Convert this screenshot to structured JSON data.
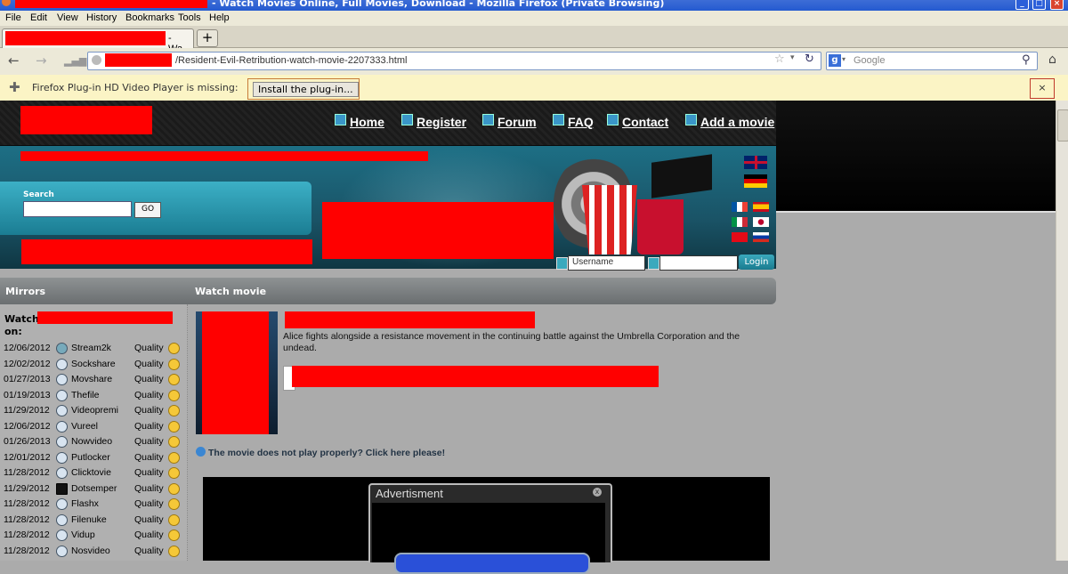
{
  "browser": {
    "window_title": "- Watch Movies Online, Full Movies, Download - Mozilla Firefox (Private Browsing)",
    "menu": [
      "File",
      "Edit",
      "View",
      "History",
      "Bookmarks",
      "Tools",
      "Help"
    ],
    "tab_label": "- Wa...",
    "new_tab": "+",
    "url": "/Resident-Evil-Retribution-watch-movie-2207333.html",
    "search_placeholder": "Google",
    "notice_text": "Firefox Plug-in HD Video Player is missing:",
    "install_label": "Install the plug-in...",
    "close_glyph": "×"
  },
  "site": {
    "nav": [
      "Home",
      "Register",
      "Forum",
      "FAQ",
      "Contact",
      "Add a movie"
    ],
    "search_label": "Search",
    "go_label": "GO",
    "username_placeholder": "Username",
    "login_label": "Login",
    "mirrors_heading": "Mirrors",
    "watch_heading": "Watch movie",
    "watch_on_label": "Watch",
    "watch_on_suffix": "on:",
    "description": "Alice fights alongside a resistance movement in the continuing battle against the Umbrella Corporation and the undead.",
    "play_issue": "The movie does not play properly? Click here please!",
    "ad_title": "Advertisment",
    "ad_close": "x"
  },
  "mirrors": [
    {
      "date": "12/06/2012",
      "name": "Stream2k",
      "quality": "Quality"
    },
    {
      "date": "12/02/2012",
      "name": "Sockshare",
      "quality": "Quality"
    },
    {
      "date": "01/27/2013",
      "name": "Movshare",
      "quality": "Quality"
    },
    {
      "date": "01/19/2013",
      "name": "Thefile",
      "quality": "Quality"
    },
    {
      "date": "11/29/2012",
      "name": "Videopremi",
      "quality": "Quality"
    },
    {
      "date": "12/06/2012",
      "name": "Vureel",
      "quality": "Quality"
    },
    {
      "date": "01/26/2013",
      "name": "Nowvideo",
      "quality": "Quality"
    },
    {
      "date": "12/01/2012",
      "name": "Putlocker",
      "quality": "Quality"
    },
    {
      "date": "11/28/2012",
      "name": "Clicktovie",
      "quality": "Quality"
    },
    {
      "date": "11/29/2012",
      "name": "Dotsemper",
      "quality": "Quality"
    },
    {
      "date": "11/28/2012",
      "name": "Flashx",
      "quality": "Quality"
    },
    {
      "date": "11/28/2012",
      "name": "Filenuke",
      "quality": "Quality"
    },
    {
      "date": "11/28/2012",
      "name": "Vidup",
      "quality": "Quality"
    },
    {
      "date": "11/28/2012",
      "name": "Nosvideo",
      "quality": "Quality"
    }
  ]
}
